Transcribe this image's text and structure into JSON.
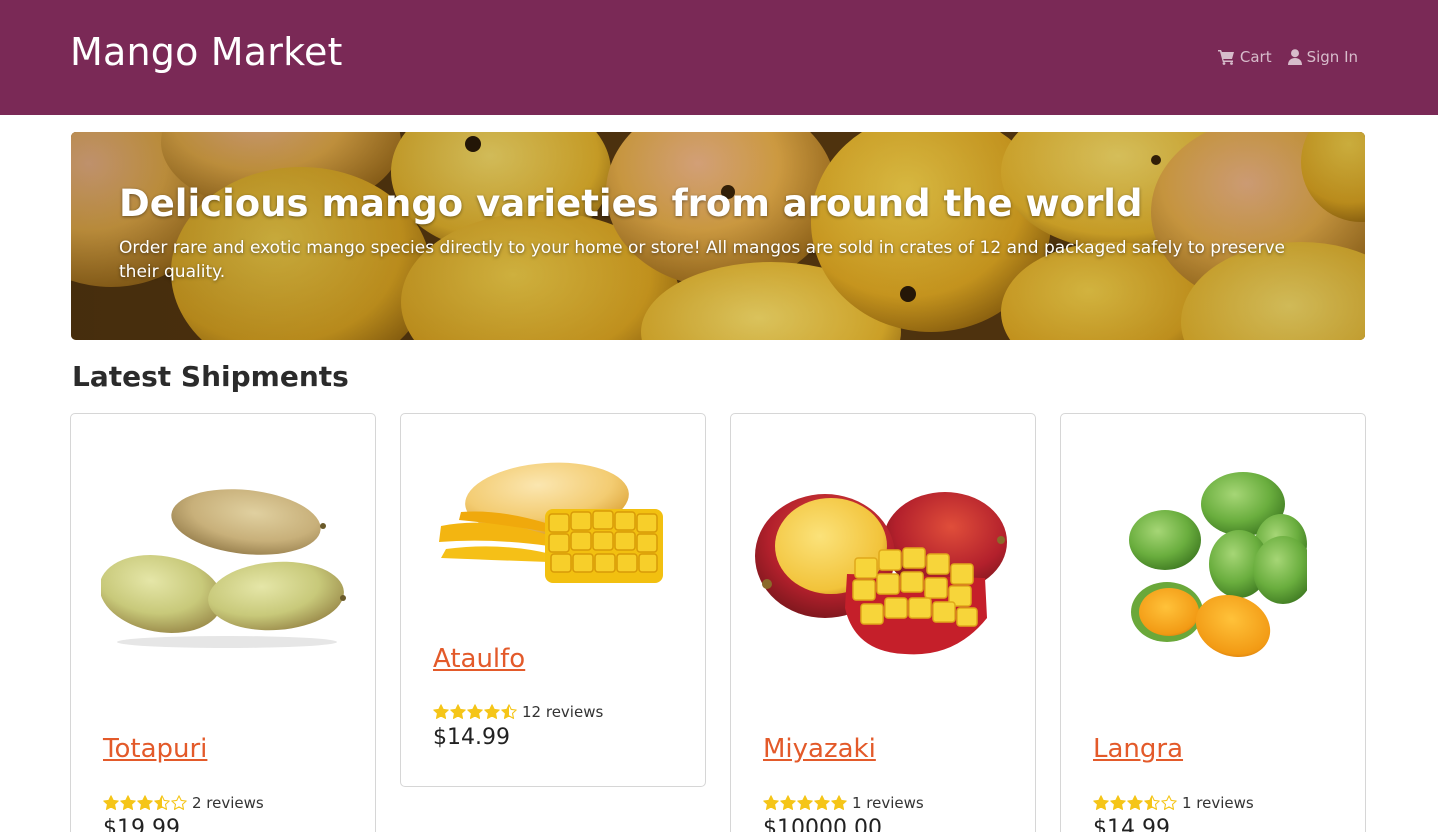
{
  "header": {
    "brand": "Mango Market",
    "cart_label": "Cart",
    "signin_label": "Sign In"
  },
  "hero": {
    "title": "Delicious mango varieties from around the world",
    "text": "Order rare and exotic mango species directly to your home or store! All mangos are sold in crates of 12 and packaged safely to preserve their quality."
  },
  "section": {
    "title": "Latest Shipments"
  },
  "products": [
    {
      "name": "Totapuri",
      "rating": 3.5,
      "reviews": "2 reviews",
      "price": "$19.99"
    },
    {
      "name": "Ataulfo",
      "rating": 4.5,
      "reviews": "12 reviews",
      "price": "$14.99"
    },
    {
      "name": "Miyazaki",
      "rating": 5,
      "reviews": "1 reviews",
      "price": "$10000.00"
    },
    {
      "name": "Langra",
      "rating": 3.5,
      "reviews": "1 reviews",
      "price": "$14.99"
    }
  ],
  "icons": {
    "cart": "cart-icon",
    "user": "user-icon",
    "star": "star-icon"
  },
  "colors": {
    "navbar": "#7a2956",
    "link": "#e35a2a",
    "star": "#f5c518",
    "nav_text": "#d7bccb"
  }
}
